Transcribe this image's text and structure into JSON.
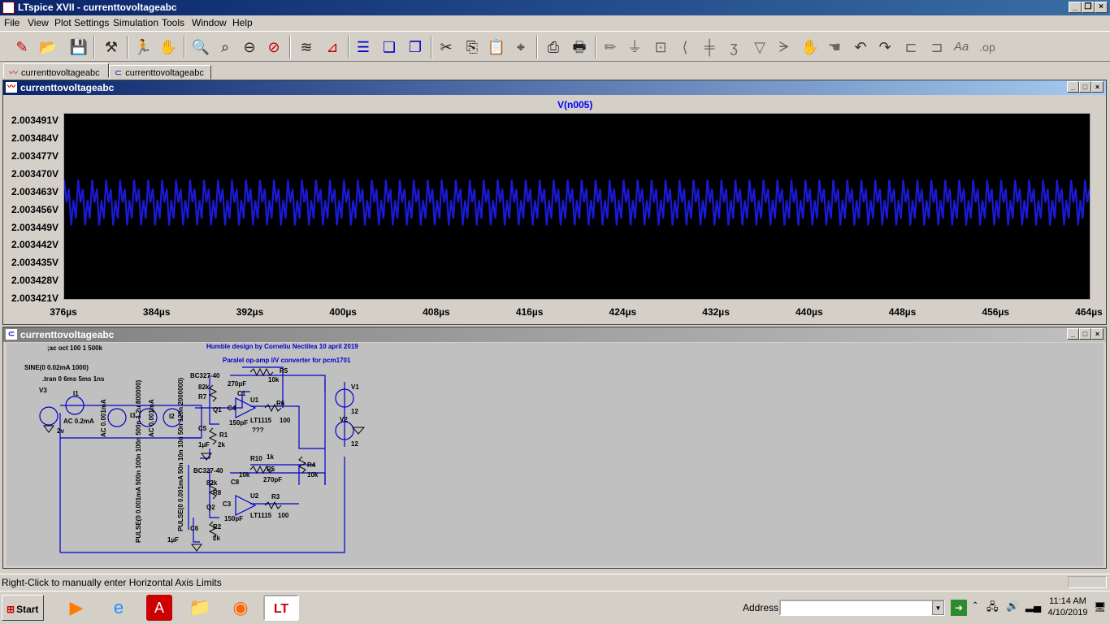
{
  "app": {
    "title": "LTspice XVII - currenttovoltageabc"
  },
  "menu": [
    "File",
    "View",
    "Plot Settings",
    "Simulation",
    "Tools",
    "Window",
    "Help"
  ],
  "tabs": [
    {
      "label": "currenttovoltageabc",
      "icon": "waveform-icon"
    },
    {
      "label": "currenttovoltageabc",
      "icon": "schematic-icon"
    }
  ],
  "waveform_window": {
    "title": "currenttovoltageabc",
    "trace_label": "V(n005)",
    "trace_color": "#1a1ad6"
  },
  "schematic_window": {
    "title": "currenttovoltageabc",
    "texts": {
      "directive_ac": ";ac oct 100 1 500k",
      "sine": "SINE(0 0.02mA 1000)",
      "tran": ".tran 0 6ms 5ms 1ns",
      "v3": "V3",
      "v3_val": "2v",
      "i1": "I1",
      "i1_val": "AC 0.2mA",
      "i3": "I3",
      "i3_val1": "AC 0.001mA",
      "i3_val2": "PULSE(0 0.001mA 500n 100n 100n 500n 1.2u 800000)",
      "i2": "I2",
      "i2_val1": "AC 0.001mA",
      "i2_val2": "PULSE(0 0.001mA 50n 10n 10n 50n 120n 2000000)",
      "humble": "Humble design by Corneliu Nectilea 10 april 2019",
      "paralel": "Paralel op-amp I/V converter for pcm1701",
      "bc1": "BC327-40",
      "bc2": "BC327-40",
      "r7": "R7",
      "r7v": "82k",
      "r8": "R8",
      "r8v": "82k",
      "r5a": "R5",
      "r5av": "10k",
      "r5b": "R5",
      "r5bv": "270pF",
      "c1": "C1",
      "c1v": "270pF",
      "u1": "U1",
      "u1v": "LT1115",
      "u2": "U2",
      "u2v": "LT1115",
      "r6": "R6",
      "r6v": "100",
      "r3": "R3",
      "r3v": "100",
      "q1": "Q1",
      "q2": "Q2",
      "c4": "C4",
      "c4v": "150pF",
      "c3": "C3",
      "c3v": "150pF",
      "c5": "C5",
      "c5v": "1µF",
      "c6": "C6",
      "c6v": "1µF",
      "c8": "C8",
      "c8v": "270pF",
      "r1": "R1",
      "r1v": "2k",
      "r2": "R2",
      "r2v": "2k",
      "r10": "R10",
      "r10v": "1k",
      "r9v": "10k",
      "r4": "R4",
      "r4v": "10k",
      "qqq": "???",
      "v1": "V1",
      "v1v": "12",
      "v2": "V2",
      "v2v": "12"
    }
  },
  "chart_data": {
    "type": "line",
    "title": "V(n005)",
    "xlabel": "",
    "ylabel": "",
    "xlim": [
      376,
      464
    ],
    "x_unit": "µs",
    "x_ticks": [
      "376µs",
      "384µs",
      "392µs",
      "400µs",
      "408µs",
      "416µs",
      "424µs",
      "432µs",
      "440µs",
      "448µs",
      "456µs",
      "464µs"
    ],
    "ylim": [
      2.003421,
      2.003494
    ],
    "y_ticks": [
      "2.003491V",
      "2.003484V",
      "2.003477V",
      "2.003470V",
      "2.003463V",
      "2.003456V",
      "2.003449V",
      "2.003442V",
      "2.003435V",
      "2.003428V",
      "2.003421V"
    ],
    "series": [
      {
        "period_us": 1.2,
        "max": 2.003468,
        "min": 2.00345,
        "mid": 2.003459
      }
    ]
  },
  "statusbar": {
    "text": "Right-Click to manually enter Horizontal Axis Limits"
  },
  "taskbar": {
    "start_label": "Start",
    "address_label": "Address",
    "address_value": "",
    "time": "11:14 AM",
    "date": "4/10/2019"
  }
}
